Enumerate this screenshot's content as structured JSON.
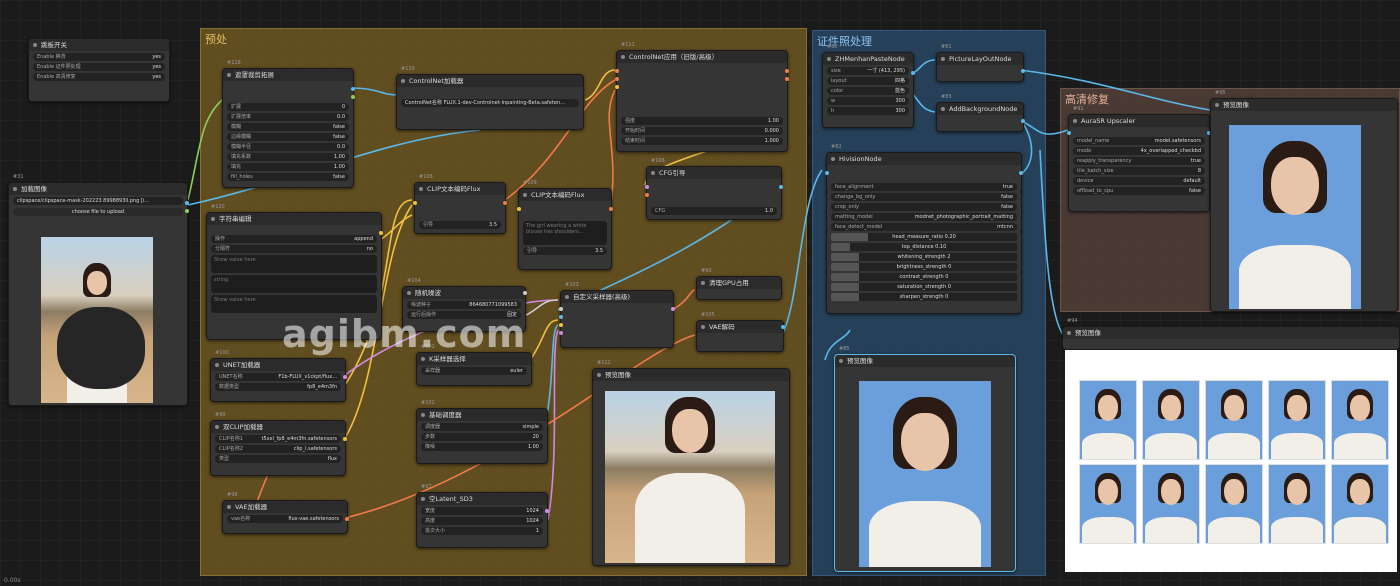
{
  "status_bar": "0.00s",
  "watermark": "agibm.com",
  "groups": {
    "preprocess": "预处",
    "idphoto": "证件照处理",
    "hires": "高清修复"
  },
  "settings_node": {
    "title": "跳板开关",
    "rows": [
      {
        "label": "Enable 换背",
        "value": "yes"
      },
      {
        "label": "Enable 证件照处理",
        "value": "yes"
      },
      {
        "label": "Enable 高清修复",
        "value": "yes"
      }
    ]
  },
  "load_image": {
    "id": "#31",
    "title": "加载图像",
    "file": "clipspace/clipspace-mask-202223.8998893ll.png [i...",
    "upload": "choose file to upload"
  },
  "crop_node": {
    "id": "#118",
    "title": "遮罩裁剪拓展",
    "rows": [
      {
        "label": "扩展",
        "value": "0"
      },
      {
        "label": "扩展倍率",
        "value": "0.0"
      },
      {
        "label": "模糊",
        "value": "false"
      },
      {
        "label": "边缘模糊",
        "value": "false"
      },
      {
        "label": "模糊半径",
        "value": "0.0"
      },
      {
        "label": "填充系数",
        "value": "1.00"
      },
      {
        "label": "填充",
        "value": "1.00"
      },
      {
        "label": "fill_holes",
        "value": "false"
      }
    ]
  },
  "controlnet_loader": {
    "id": "#110",
    "title": "ControlNet加载器",
    "model": "ControlNet名称  FLUX.1-dev-Controlnet-Inpainting-Beta.safeten..."
  },
  "controlnet_apply": {
    "id": "#111",
    "title": "ControlNet应用（旧版/高级）",
    "rows": [
      {
        "label": "强度",
        "value": "1.00"
      },
      {
        "label": "开始时间",
        "value": "0.000"
      },
      {
        "label": "结束时间",
        "value": "1.000"
      }
    ]
  },
  "clip_encode_1": {
    "id": "#108",
    "title": "CLIP文本编码Flux",
    "guidance_label": "引导",
    "guidance": "3.5"
  },
  "clip_encode_2": {
    "id": "#109",
    "title": "CLIP文本编码Flux",
    "prompt": "The girl wearing a white blouse has shoulders...",
    "guidance_label": "引导",
    "guidance": "3.5"
  },
  "cfg_guider": {
    "id": "#106",
    "title": "CFG引导",
    "cfg_label": "CFG",
    "cfg": "1.0"
  },
  "text_concat": {
    "id": "#120",
    "title": "字符串编辑",
    "rows": [
      {
        "label": "操作",
        "value": "append"
      },
      {
        "label": "分隔符",
        "value": "no"
      }
    ],
    "placeholders": [
      "Show value here",
      "string",
      "Show value here"
    ]
  },
  "random_noise": {
    "id": "#104",
    "title": "随机噪波",
    "rows": [
      {
        "label": "噪波种子",
        "value": "864680771099583"
      },
      {
        "label": "运行后操作",
        "value": "固定"
      }
    ]
  },
  "ksampler": {
    "id": "#103",
    "title": "自定义采样器(高级)"
  },
  "sampler_select": {
    "id": "#101",
    "title": "K采样器选择",
    "rows": [
      {
        "label": "采样器",
        "value": "euler"
      }
    ]
  },
  "scheduler": {
    "id": "#102",
    "title": "基础调度器",
    "rows": [
      {
        "label": "调度器",
        "value": "simple"
      },
      {
        "label": "步数",
        "value": "20"
      },
      {
        "label": "降噪",
        "value": "1.00"
      }
    ]
  },
  "unet_loader": {
    "id": "#100",
    "title": "UNET加载器",
    "rows": [
      {
        "label": "UNET名称",
        "value": "F1b-FLUX_v1ckpt/flux..."
      },
      {
        "label": "数据类型",
        "value": "fp8_e4m3fn"
      }
    ]
  },
  "dual_clip": {
    "id": "#99",
    "title": "双CLIP加载器",
    "rows": [
      {
        "label": "CLIP名称1",
        "value": "t5xxl_fp8_e4m3fn.safetensors"
      },
      {
        "label": "CLIP名称2",
        "value": "clip_l.safetensors"
      },
      {
        "label": "类型",
        "value": "flux"
      }
    ]
  },
  "vae_loader": {
    "id": "#98",
    "title": "VAE加载器",
    "rows": [
      {
        "label": "vae名称",
        "value": "flux-vae.safetensors"
      }
    ]
  },
  "empty_latent": {
    "id": "#97",
    "title": "空Latent_SD3",
    "rows": [
      {
        "label": "宽度",
        "value": "1024"
      },
      {
        "label": "高度",
        "value": "1024"
      },
      {
        "label": "批次大小",
        "value": "1"
      }
    ]
  },
  "gpu_node": {
    "id": "#93",
    "title": "清理GPU占用"
  },
  "vae_decode": {
    "id": "#105",
    "title": "VAE解码"
  },
  "preview_1": {
    "id": "#112",
    "title": "预览图像"
  },
  "zhhm_node": {
    "id": "#80",
    "title": "ZHMenhanPasteNode",
    "rows": [
      {
        "label": "size",
        "value": "一寸 (413, 295)"
      },
      {
        "label": "layout",
        "value": "四格"
      },
      {
        "label": "color",
        "value": "蓝色"
      },
      {
        "label": "w",
        "value": "300"
      },
      {
        "label": "h",
        "value": "300"
      }
    ]
  },
  "picture_layout": {
    "id": "#81",
    "title": "PictureLayOutNode"
  },
  "add_background": {
    "id": "#83",
    "title": "AddBackgroundNode"
  },
  "hivision_node": {
    "id": "#82",
    "title": "HivisionNode",
    "rows": [
      {
        "label": "face_alignment",
        "value": "true"
      },
      {
        "label": "change_bg_only",
        "value": "false"
      },
      {
        "label": "crop_only",
        "value": "false"
      },
      {
        "label": "matting_model",
        "value": "modnet_photographic_portrait_matting"
      },
      {
        "label": "face_detect_model",
        "value": "mtcnn"
      }
    ],
    "bars": [
      {
        "label": "head_measure_ratio",
        "value": "0.20",
        "pct": 0.2
      },
      {
        "label": "top_distance",
        "value": "0.10",
        "pct": 0.1
      },
      {
        "label": "whitening_strength",
        "value": "2",
        "pct": 0.15
      },
      {
        "label": "brightness_strength",
        "value": "0",
        "pct": 0.15
      },
      {
        "label": "contrast_strength",
        "value": "0",
        "pct": 0.15
      },
      {
        "label": "saturation_strength",
        "value": "0",
        "pct": 0.15
      },
      {
        "label": "sharpen_strength",
        "value": "0",
        "pct": 0.15
      }
    ]
  },
  "preview_2": {
    "id": "#85",
    "title": "预览图像"
  },
  "upscaler": {
    "id": "#91",
    "title": "AuraSR Upscaler",
    "rows": [
      {
        "label": "model_name",
        "value": "model.safetensors"
      },
      {
        "label": "mode",
        "value": "4x_overlapped_checkbd"
      },
      {
        "label": "reapply_transparency",
        "value": "true"
      },
      {
        "label": "tile_batch_size",
        "value": "8"
      },
      {
        "label": "device",
        "value": "default"
      },
      {
        "label": "offload_to_cpu",
        "value": "false"
      }
    ]
  },
  "preview_3": {
    "id": "#95",
    "title": "预览图像"
  },
  "preview_4": {
    "id": "#94",
    "title": "预览图像"
  },
  "colors": {
    "yellow_link": "#f0c040",
    "purple_link": "#d08be0",
    "blue_link": "#5bb8e8",
    "orange_link": "#f07a4a",
    "photo_bg_blue": "#6a9fdc"
  }
}
